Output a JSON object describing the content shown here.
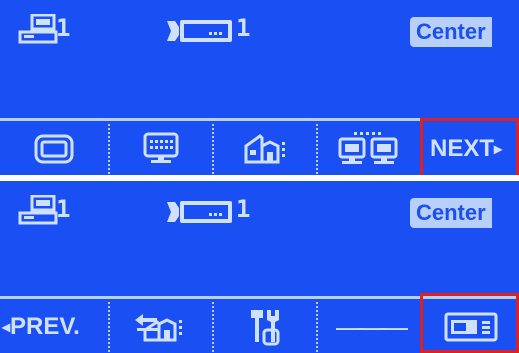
{
  "screens": [
    {
      "status": {
        "monitor_count": "1",
        "camera_count": "1",
        "mode": "Center",
        "monitor_icon": "monitor-stack-icon",
        "camera_icon": "camera-icon"
      },
      "softkeys": [
        {
          "icon": "screen-frame-icon"
        },
        {
          "icon": "keyboard-monitor-icon"
        },
        {
          "icon": "house-camera-icon"
        },
        {
          "icon": "dual-monitor-icon"
        },
        {
          "label": "NEXT",
          "arrow": "▸",
          "selected": true
        }
      ]
    },
    {
      "status": {
        "monitor_count": "1",
        "camera_count": "1",
        "mode": "Center",
        "monitor_icon": "monitor-stack-icon",
        "camera_icon": "camera-icon"
      },
      "softkeys": [
        {
          "label": "PREV.",
          "arrow": "◂"
        },
        {
          "icon": "house-arrow-icon"
        },
        {
          "icon": "tools-icon"
        },
        {
          "label": "———"
        },
        {
          "icon": "control-panel-icon",
          "selected": true
        }
      ]
    }
  ],
  "colors": {
    "background": "#1a4ff4",
    "foreground": "#cfe1ff",
    "mode_badge": "#b8cff7",
    "selection": "#e0201e"
  }
}
